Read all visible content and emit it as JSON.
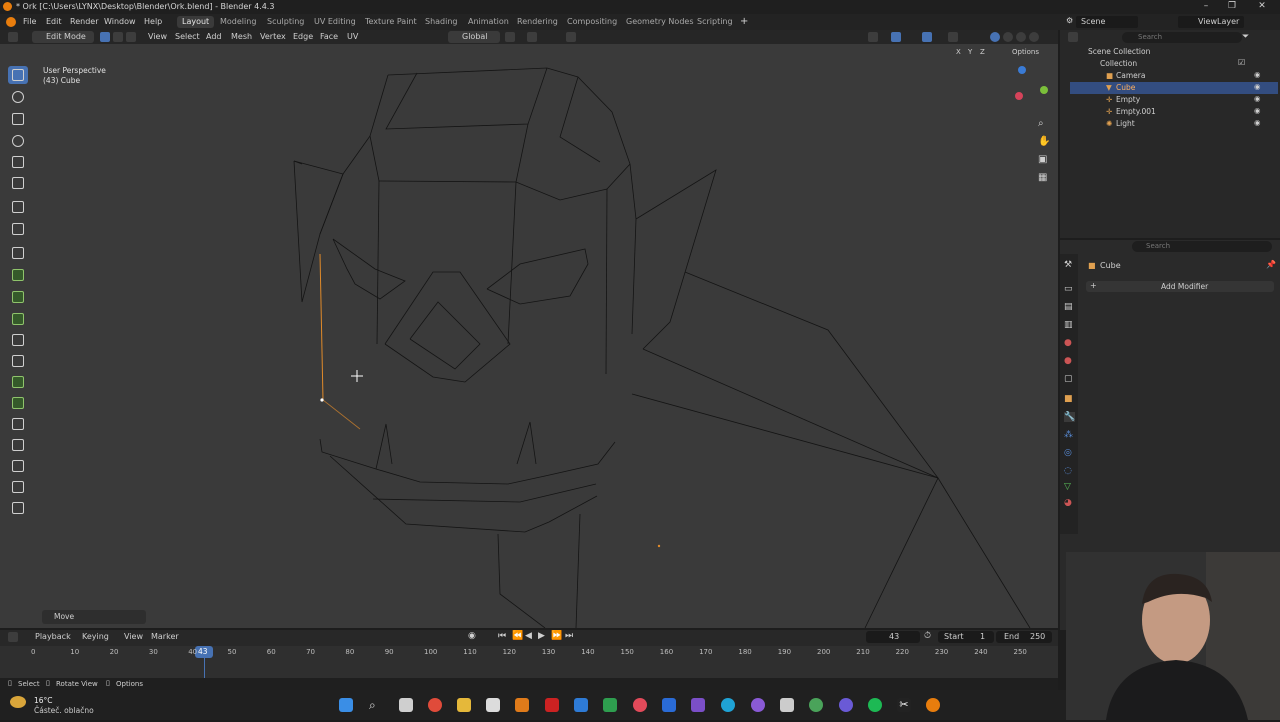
{
  "titlebar": {
    "title": "* Ork [C:\\Users\\LYNX\\Desktop\\Blender\\Ork.blend] - Blender 4.4.3"
  },
  "menu": {
    "items": [
      "File",
      "Edit",
      "Render",
      "Window",
      "Help"
    ]
  },
  "workspaces": [
    "Layout",
    "Modeling",
    "Sculpting",
    "UV Editing",
    "Texture Paint",
    "Shading",
    "Animation",
    "Rendering",
    "Compositing",
    "Geometry Nodes",
    "Scripting"
  ],
  "active_workspace": "Layout",
  "scene": {
    "label": "Scene",
    "view_layer": "ViewLayer"
  },
  "viewport_header": {
    "mode": "Edit Mode",
    "view": "View",
    "select": "Select",
    "add": "Add",
    "mesh": "Mesh",
    "vertex": "Vertex",
    "edge": "Edge",
    "face": "Face",
    "uv": "UV",
    "orientation": "Global",
    "options": "Options"
  },
  "viewport": {
    "perspective": "User Perspective",
    "object_info": "(43) Cube",
    "operator_panel": "Move",
    "axes": [
      "X",
      "Y",
      "Z"
    ]
  },
  "outliner": {
    "search_placeholder": "Search",
    "root": "Scene Collection",
    "collection": "Collection",
    "items": [
      "Camera",
      "Cube",
      "Empty",
      "Empty.001",
      "Light"
    ],
    "selected": "Cube"
  },
  "properties": {
    "search_placeholder": "Search",
    "object": "Cube",
    "add_modifier": "Add Modifier"
  },
  "timeline": {
    "playback": "Playback",
    "keying": "Keying",
    "view": "View",
    "marker": "Marker",
    "current_frame": "43",
    "start_label": "Start",
    "start": "1",
    "end_label": "End",
    "end": "250",
    "ticks": [
      "0",
      "10",
      "20",
      "30",
      "40",
      "50",
      "60",
      "70",
      "80",
      "90",
      "100",
      "110",
      "120",
      "130",
      "140",
      "150",
      "160",
      "170",
      "180",
      "190",
      "200",
      "210",
      "220",
      "230",
      "240",
      "250"
    ]
  },
  "statusbar": {
    "select": "Select",
    "rotate": "Rotate View",
    "options": "Options"
  },
  "weather": {
    "temp": "16°C",
    "desc": "Částeč. oblačno"
  },
  "colors": {
    "accent": "#4772b3",
    "selected_edge": "#e08a2a",
    "background": "#3a3a3a"
  }
}
